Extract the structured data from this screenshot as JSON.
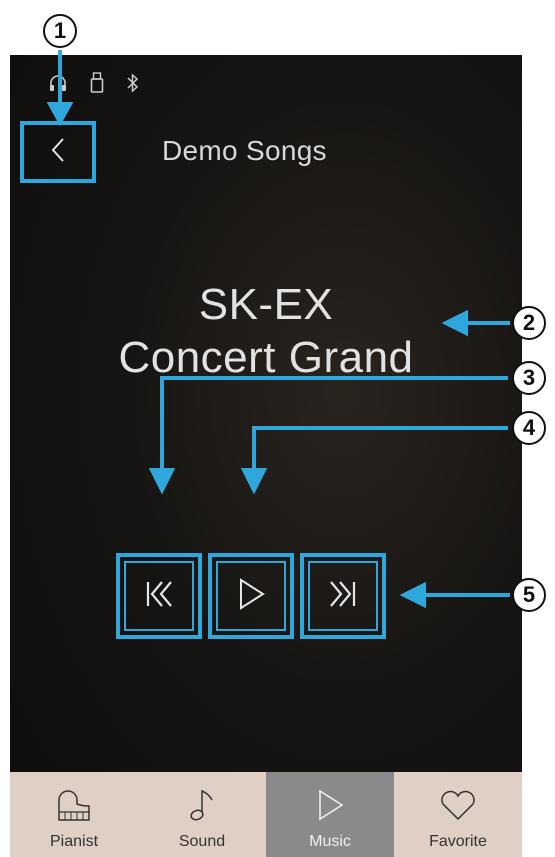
{
  "header": {
    "title": "Demo Songs"
  },
  "song": {
    "line1": "SK-EX",
    "line2": "Concert Grand"
  },
  "status_icons": [
    "headphone-icon",
    "usb-icon",
    "bluetooth-icon"
  ],
  "controls": [
    {
      "name": "previous-button",
      "icon": "previous-icon"
    },
    {
      "name": "play-button",
      "icon": "play-icon"
    },
    {
      "name": "next-button",
      "icon": "next-icon"
    }
  ],
  "nav": [
    {
      "label": "Pianist",
      "icon": "piano-icon",
      "active": false
    },
    {
      "label": "Sound",
      "icon": "note-icon",
      "active": false
    },
    {
      "label": "Music",
      "icon": "play-outline-icon",
      "active": true
    },
    {
      "label": "Favorite",
      "icon": "heart-icon",
      "active": false
    }
  ],
  "callouts": [
    "1",
    "2",
    "3",
    "4",
    "5"
  ],
  "colors": {
    "highlight": "#2ea8dc",
    "nav_bg": "#dfcfc4",
    "nav_active": "#8a8a8c",
    "screen_bg": "#141210"
  }
}
